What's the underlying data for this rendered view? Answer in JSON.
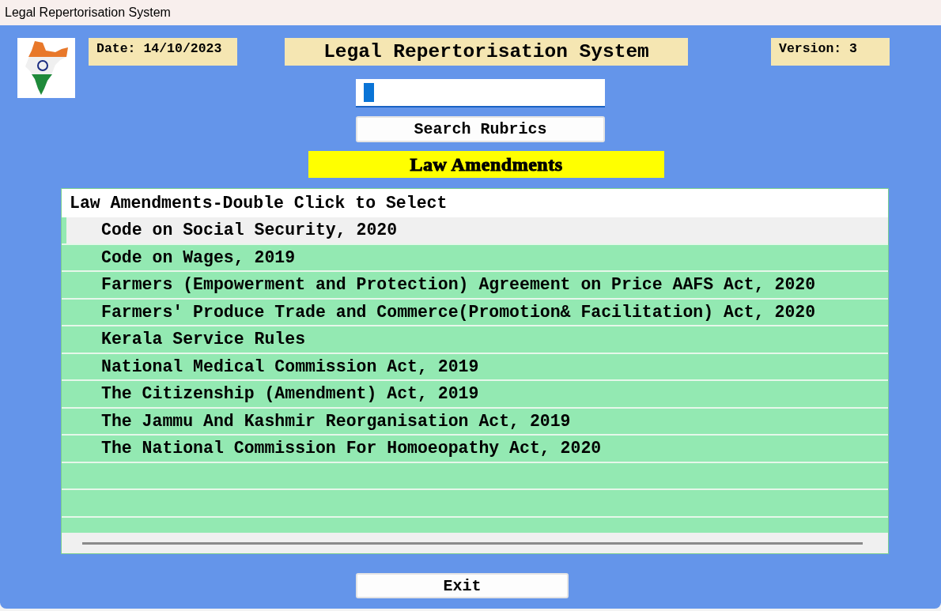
{
  "window": {
    "title": "Legal Repertorisation System"
  },
  "header": {
    "date": "Date: 14/10/2023",
    "title": "Legal Repertorisation System",
    "version": "Version: 3"
  },
  "search": {
    "button": "Search Rubrics"
  },
  "section_title": "Law Amendments",
  "list": {
    "heading": "Law Amendments-Double Click to Select",
    "items": [
      {
        "label": "Code on Social Security, 2020",
        "selected": true
      },
      {
        "label": "Code on Wages, 2019",
        "selected": false
      },
      {
        "label": "Farmers (Empowerment and Protection) Agreement on Price AAFS Act, 2020",
        "selected": false
      },
      {
        "label": "Farmers' Produce Trade and Commerce(Promotion& Facilitation) Act, 2020",
        "selected": false
      },
      {
        "label": "Kerala Service Rules",
        "selected": false
      },
      {
        "label": "National Medical Commission Act, 2019",
        "selected": false
      },
      {
        "label": "The Citizenship (Amendment) Act, 2019",
        "selected": false
      },
      {
        "label": "The Jammu And Kashmir Reorganisation Act, 2019",
        "selected": false
      },
      {
        "label": "The National Commission For Homoeopathy Act, 2020",
        "selected": false
      }
    ]
  },
  "buttons": [
    "Exit"
  ]
}
